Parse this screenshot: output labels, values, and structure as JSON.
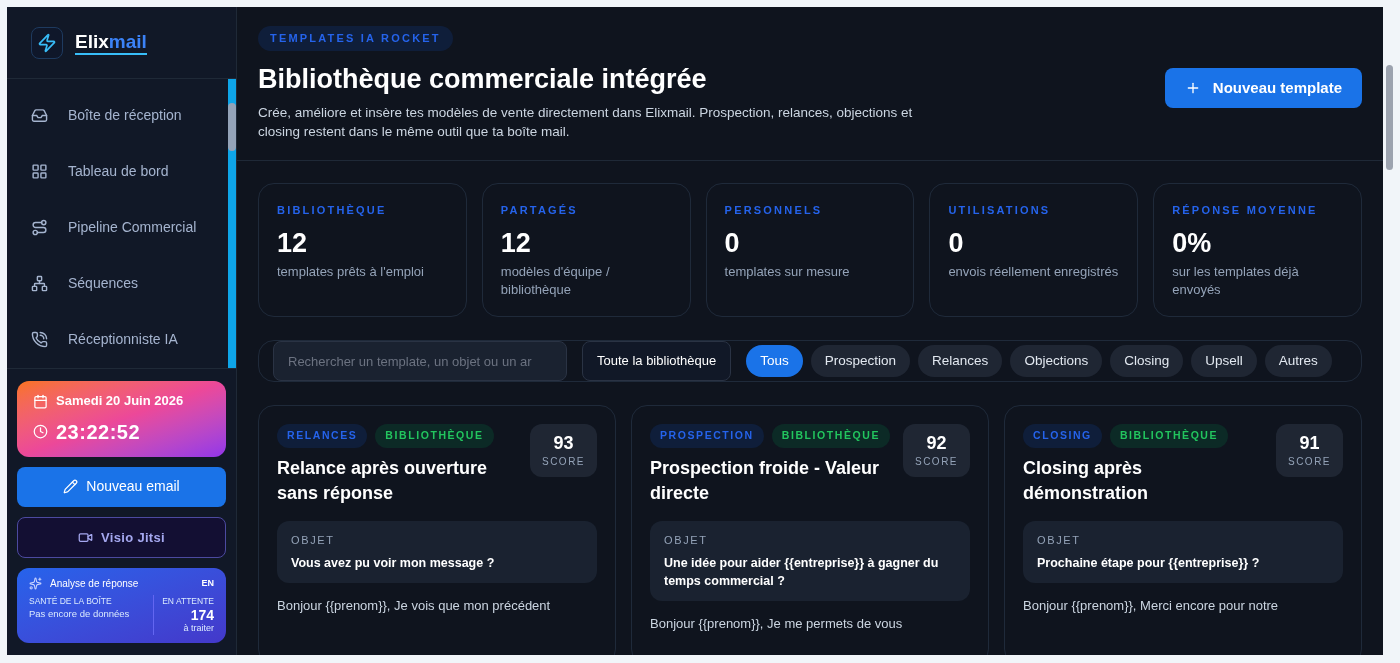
{
  "brand": {
    "name_part_1": "Elix",
    "name_part_2": "mail"
  },
  "nav": [
    {
      "label": "Boîte de réception",
      "selected": false
    },
    {
      "label": "Tableau de bord",
      "selected": false
    },
    {
      "label": "Pipeline Commercial",
      "selected": false
    },
    {
      "label": "Séquences",
      "selected": false
    },
    {
      "label": "Réceptionniste IA",
      "selected": false
    }
  ],
  "clock": {
    "date": "Samedi 20 Juin 2026",
    "time": "23:22:52"
  },
  "actions": [
    {
      "label": "Nouveau email",
      "kind": "primary"
    },
    {
      "label": "Visio Jitsi",
      "kind": "video"
    }
  ],
  "analysis": {
    "title": "Analyse de réponse",
    "lang": "EN",
    "health_label": "SANTÉ DE LA BOÎTE",
    "health_value": "Pas encore de données",
    "pending_label": "EN ATTENTE",
    "pending_count": "174",
    "pending_note": "à traiter"
  },
  "header": {
    "eyebrow": "TEMPLATES IA ROCKET",
    "title": "Bibliothèque commerciale intégrée",
    "description": "Crée, améliore et insère tes modèles de vente directement dans Elixmail. Prospection, relances, objections et closing restent dans le même outil que ta boîte mail.",
    "button": "Nouveau template"
  },
  "stats": [
    {
      "label": "BIBLIOTHÈQUE",
      "value": "12",
      "note": "templates prêts à l'emploi"
    },
    {
      "label": "PARTAGÉS",
      "value": "12",
      "note": "modèles d'équipe / bibliothèque"
    },
    {
      "label": "PERSONNELS",
      "value": "0",
      "note": "templates sur mesure"
    },
    {
      "label": "UTILISATIONS",
      "value": "0",
      "note": "envois réellement enregistrés"
    },
    {
      "label": "RÉPONSE MOYENNE",
      "value": "0%",
      "note": "sur les templates déjà envoyés"
    }
  ],
  "filters": {
    "search_placeholder": "Rechercher un template, un objet ou un ar",
    "scope": "Toute la bibliothèque",
    "chips": [
      {
        "label": "Tous",
        "selected": true
      },
      {
        "label": "Prospection",
        "selected": false
      },
      {
        "label": "Relances",
        "selected": false
      },
      {
        "label": "Objections",
        "selected": false
      },
      {
        "label": "Closing",
        "selected": false
      },
      {
        "label": "Upsell",
        "selected": false
      },
      {
        "label": "Autres",
        "selected": false
      }
    ]
  },
  "templates": [
    {
      "category": "RELANCES",
      "source": "BIBLIOTHÈQUE",
      "score": "93",
      "score_label": "SCORE",
      "title": "Relance après ouverture sans réponse",
      "subject_label": "OBJET",
      "subject": "Vous avez pu voir mon message ?",
      "body": "Bonjour {{prenom}}, Je vois que mon précédent"
    },
    {
      "category": "PROSPECTION",
      "source": "BIBLIOTHÈQUE",
      "score": "92",
      "score_label": "SCORE",
      "title": "Prospection froide - Valeur directe",
      "subject_label": "OBJET",
      "subject": "Une idée pour aider {{entreprise}} à gagner du temps commercial ?",
      "body": "Bonjour {{prenom}}, Je me permets de vous"
    },
    {
      "category": "CLOSING",
      "source": "BIBLIOTHÈQUE",
      "score": "91",
      "score_label": "SCORE",
      "title": "Closing après démonstration",
      "subject_label": "OBJET",
      "subject": "Prochaine étape pour {{entreprise}} ?",
      "body": "Bonjour {{prenom}}, Merci encore pour notre"
    }
  ]
}
